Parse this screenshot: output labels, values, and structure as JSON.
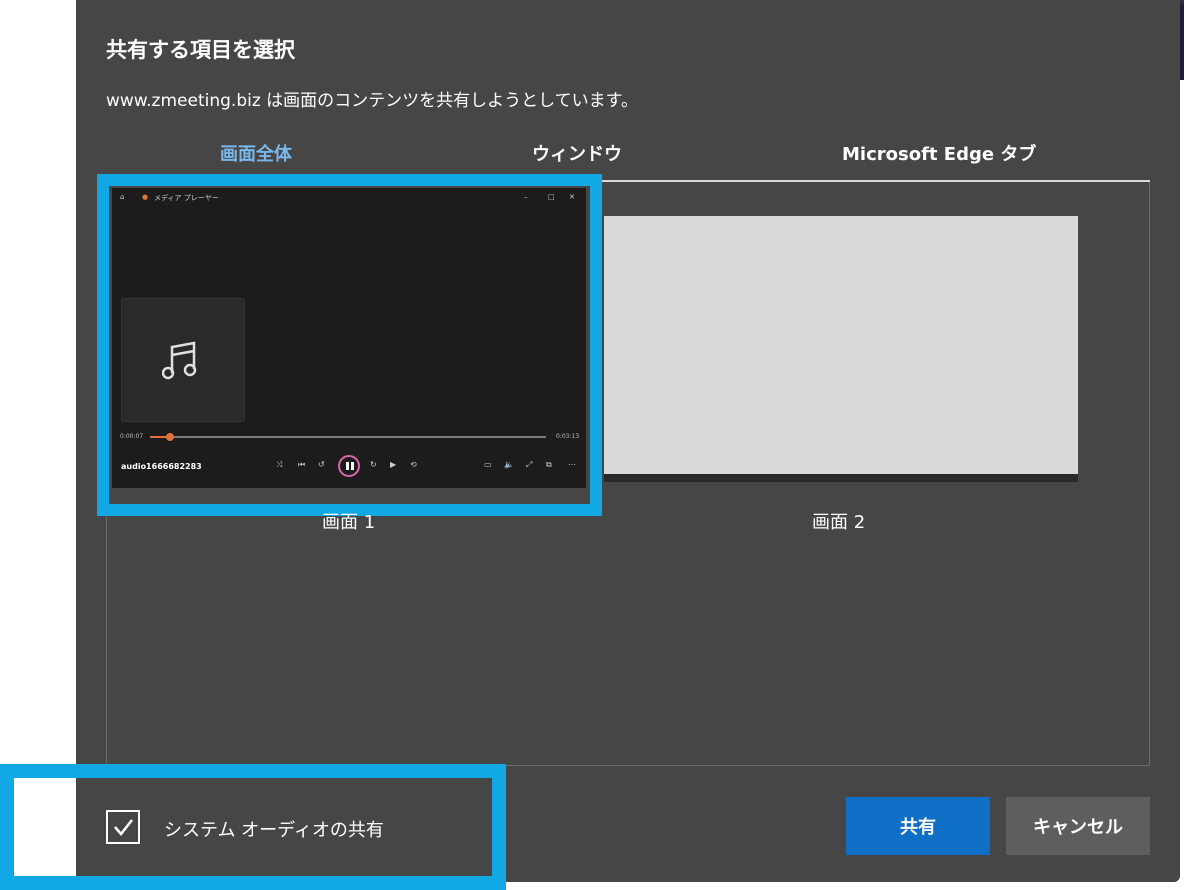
{
  "dialog": {
    "title": "共有する項目を選択",
    "subtitle": "www.zmeeting.biz は画面のコンテンツを共有しようとしています。"
  },
  "tabs": [
    {
      "label": "画面全体",
      "active": true
    },
    {
      "label": "ウィンドウ",
      "active": false
    },
    {
      "label": "Microsoft Edge タブ",
      "active": false
    }
  ],
  "screens": [
    {
      "label": "画面 1",
      "selected": true
    },
    {
      "label": "画面 2",
      "selected": false
    }
  ],
  "media_player": {
    "app_name": "メディア プレーヤー",
    "track_name": "audio1666682283",
    "time_elapsed": "0:00:07",
    "time_total": "0:03:13",
    "progress": 0.05
  },
  "audio_checkbox": {
    "label": "システム オーディオの共有",
    "checked": true
  },
  "buttons": {
    "share": "共有",
    "cancel": "キャンセル"
  },
  "colors": {
    "dialog_bg": "#464646",
    "accent": "#7ab7ea",
    "highlight": "#12a8e6",
    "primary_button": "#0f6fc6",
    "progress": "#e2713a"
  }
}
